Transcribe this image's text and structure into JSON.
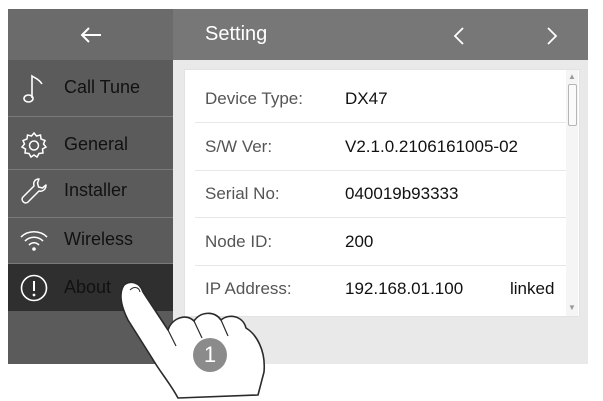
{
  "header": {
    "back_icon": "arrow-left-icon",
    "title": "Setting",
    "prev_icon": "chevron-left-icon",
    "next_icon": "chevron-right-icon"
  },
  "sidebar": {
    "items": [
      {
        "label": "Call Tune",
        "icon": "music-note-icon"
      },
      {
        "label": "General",
        "icon": "gear-icon"
      },
      {
        "label": "Installer",
        "icon": "wrench-icon"
      },
      {
        "label": "Wireless",
        "icon": "wifi-icon"
      },
      {
        "label": "About",
        "icon": "info-circle-icon",
        "active": true
      }
    ]
  },
  "about": {
    "rows": [
      {
        "label": "Device Type:",
        "value": "DX47"
      },
      {
        "label": "S/W Ver:",
        "value": "V2.1.0.2106161005-02"
      },
      {
        "label": "Serial No:",
        "value": "040019b93333"
      },
      {
        "label": "Node ID:",
        "value": "200"
      },
      {
        "label": "IP Address:",
        "value": "192.168.01.100",
        "status": "linked"
      }
    ]
  },
  "annotation": {
    "step_number": "1",
    "pointer_icon": "hand-pointer-icon"
  },
  "colors": {
    "sidebar_bg": "#5b5b5b",
    "active_item_bg": "#2f2f2f",
    "header_bg": "#777777",
    "content_bg": "#e9e9e9"
  }
}
